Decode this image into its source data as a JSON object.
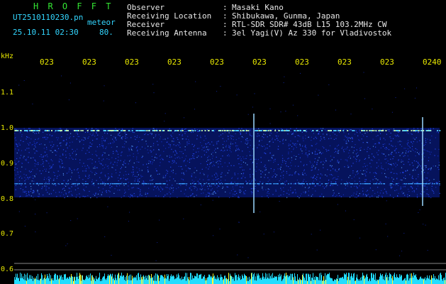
{
  "header": {
    "brand": "H R O F F T",
    "filename": "UT2510110230.pn",
    "mode": "meteor",
    "datetime": "25.10.11 02:30",
    "value": "80.",
    "info": [
      {
        "key": "Observer",
        "value": "Masaki Kano"
      },
      {
        "key": "Receiving Location",
        "value": "Shibukawa, Gunma, Japan"
      },
      {
        "key": "Receiver",
        "value": "RTL-SDR SDR# 43dB L15 103.2MHz CW"
      },
      {
        "key": "Receiving Antenna",
        "value": "3el Yagi(V) Az 330 for Vladivostok"
      }
    ]
  },
  "x_axis": {
    "ticks": [
      "023",
      "023",
      "023",
      "023",
      "023",
      "023",
      "023",
      "023",
      "023",
      "0240"
    ]
  },
  "y_axis": {
    "unit": "kHz",
    "ticks": [
      "1.1",
      "1.0",
      "0.9",
      "0.8",
      "0.7",
      "0.6"
    ]
  },
  "colors": {
    "background": "#000000",
    "text_cyan": "#33d6ff",
    "text_white": "#e8e8e8",
    "text_green": "#33e633",
    "text_yellow": "#e8e800",
    "noise_blue": "#1a3cff",
    "bottom_bars": "#22ddff"
  }
}
